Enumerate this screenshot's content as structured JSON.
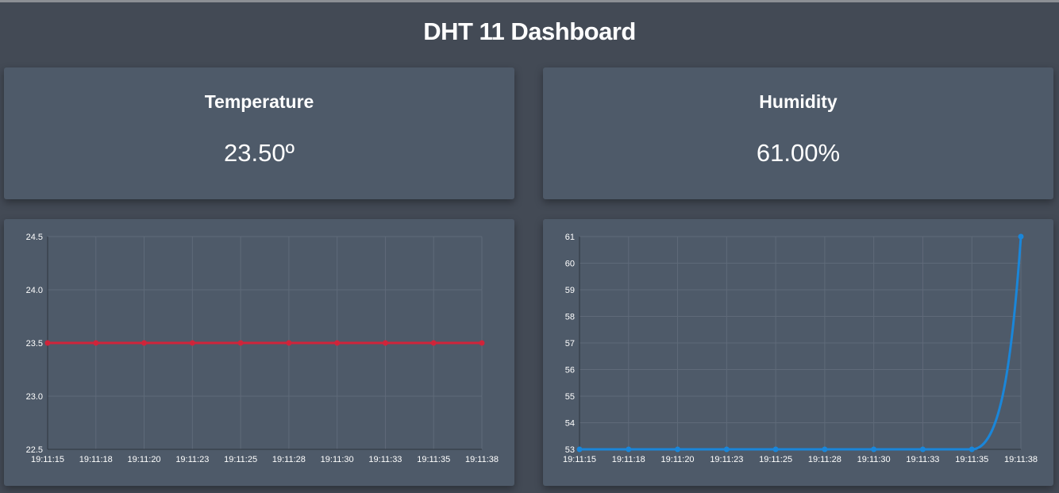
{
  "page": {
    "title": "DHT 11 Dashboard"
  },
  "cards": {
    "temperature": {
      "title": "Temperature",
      "value": "23.50º"
    },
    "humidity": {
      "title": "Humidity",
      "value": "61.00%"
    }
  },
  "chart_data": [
    {
      "type": "line",
      "x": [
        "19:11:15",
        "19:11:18",
        "19:11:20",
        "19:11:23",
        "19:11:25",
        "19:11:28",
        "19:11:30",
        "19:11:33",
        "19:11:35",
        "19:11:38"
      ],
      "series": [
        {
          "values": [
            23.5,
            23.5,
            23.5,
            23.5,
            23.5,
            23.5,
            23.5,
            23.5,
            23.5,
            23.5
          ],
          "color": "#d0243a"
        }
      ],
      "ylim": [
        22.5,
        24.5
      ],
      "yticks": [
        "22.5",
        "23.0",
        "23.5",
        "24.0",
        "24.5"
      ],
      "grid": true
    },
    {
      "type": "line",
      "x": [
        "19:11:15",
        "19:11:18",
        "19:11:20",
        "19:11:23",
        "19:11:25",
        "19:11:28",
        "19:11:30",
        "19:11:33",
        "19:11:35",
        "19:11:38"
      ],
      "series": [
        {
          "values": [
            53,
            53,
            53,
            53,
            53,
            53,
            53,
            53,
            53,
            61
          ],
          "color": "#1a86d9"
        }
      ],
      "ylim": [
        53,
        61
      ],
      "yticks": [
        "53",
        "54",
        "55",
        "56",
        "57",
        "58",
        "59",
        "60",
        "61"
      ],
      "grid": true
    }
  ]
}
